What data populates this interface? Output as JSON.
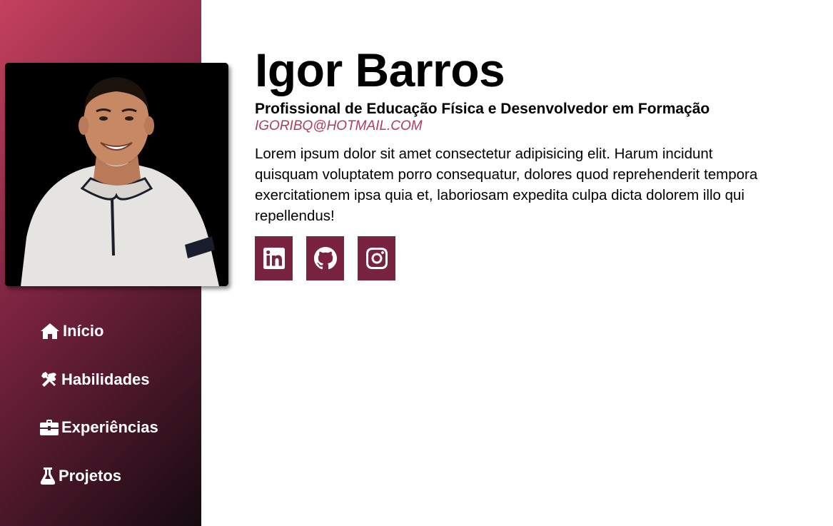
{
  "profile": {
    "name": "Igor Barros",
    "subtitle": "Profissional de Educação Física e Desenvolvedor em Formação",
    "email": "IGORIBQ@HOTMAIL.COM",
    "bio": "Lorem ipsum dolor sit amet consectetur adipisicing elit. Harum incidunt quisquam voluptatem porro consequatur, dolores quod reprehenderit tempora exercitationem ipsa quia et, laboriosam expedita culpa dicta dolorem illo qui repellendus!"
  },
  "socials": [
    {
      "icon": "linkedin-icon"
    },
    {
      "icon": "github-icon"
    },
    {
      "icon": "instagram-icon"
    }
  ],
  "nav": {
    "items": [
      {
        "label": "Início",
        "icon": "home-icon"
      },
      {
        "label": "Habilidades",
        "icon": "tools-icon"
      },
      {
        "label": "Experiências",
        "icon": "briefcase-icon"
      },
      {
        "label": "Projetos",
        "icon": "flask-icon"
      }
    ]
  },
  "colors": {
    "accent": "#7a2340",
    "accent_light": "#c4415f",
    "email": "#b13b5a",
    "sidebar_dark": "#150a10"
  }
}
